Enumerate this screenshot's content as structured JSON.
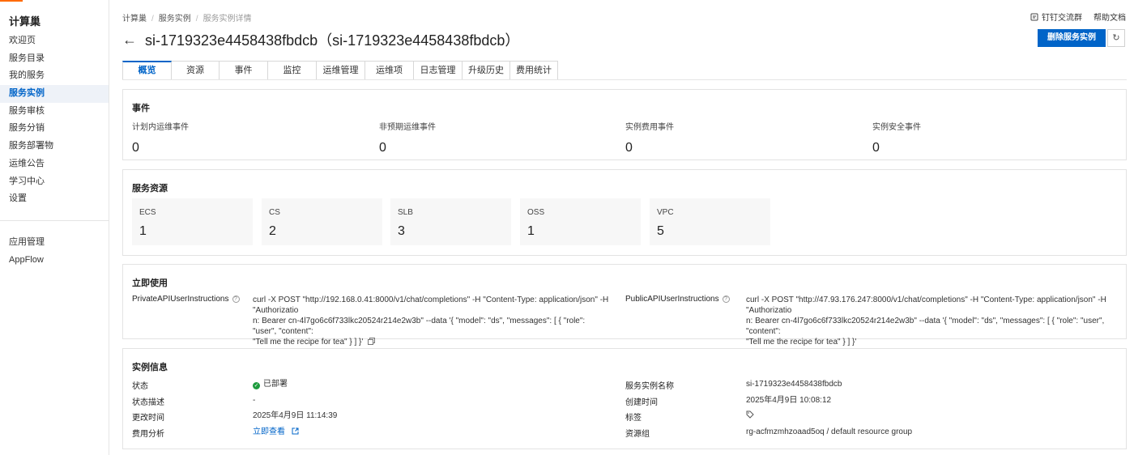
{
  "sidebar": {
    "brand": "计算巢",
    "items": [
      {
        "label": "欢迎页"
      },
      {
        "label": "服务目录"
      },
      {
        "label": "我的服务"
      },
      {
        "label": "服务实例"
      },
      {
        "label": "服务审核"
      },
      {
        "label": "服务分销"
      },
      {
        "label": "服务部署物"
      },
      {
        "label": "运维公告"
      },
      {
        "label": "学习中心"
      },
      {
        "label": "设置"
      }
    ],
    "active_index": 3,
    "items2": [
      {
        "label": "应用管理"
      },
      {
        "label": "AppFlow"
      }
    ],
    "collapse_icon": "chevron-left-icon"
  },
  "breadcrumb": [
    "计算巢",
    "服务实例",
    "服务实例详情"
  ],
  "header": {
    "title": "si-1719323e4458438fbdcb（si-1719323e4458438fbdcb）",
    "delete_button": "删除服务实例",
    "links": [
      "钉钉交流群",
      "帮助文档"
    ]
  },
  "tabs": [
    {
      "label": "概览",
      "active": true
    },
    {
      "label": "资源"
    },
    {
      "label": "事件"
    },
    {
      "label": "监控"
    },
    {
      "label": "运维管理"
    },
    {
      "label": "运维项"
    },
    {
      "label": "日志管理"
    },
    {
      "label": "升级历史"
    },
    {
      "label": "费用统计"
    }
  ],
  "events": {
    "title": "事件",
    "items": [
      {
        "label": "计划内运维事件",
        "value": "0"
      },
      {
        "label": "非预期运维事件",
        "value": "0"
      },
      {
        "label": "实例费用事件",
        "value": "0"
      },
      {
        "label": "实例安全事件",
        "value": "0"
      }
    ]
  },
  "resources": {
    "title": "服务资源",
    "items": [
      {
        "label": "ECS",
        "value": "1"
      },
      {
        "label": "CS",
        "value": "2"
      },
      {
        "label": "SLB",
        "value": "3"
      },
      {
        "label": "OSS",
        "value": "1"
      },
      {
        "label": "VPC",
        "value": "5"
      }
    ]
  },
  "usage": {
    "title": "立即使用",
    "private_label": "PrivateAPIUserInstructions",
    "private_lines": [
      "curl -X POST \"http://192.168.0.41:8000/v1/chat/completions\" -H \"Content-Type: application/json\" -H \"Authorizatio",
      "n: Bearer cn-4l7go6c6f733lkc20524r214e2w3b\" --data '{ \"model\": \"ds\", \"messages\": [ { \"role\": \"user\", \"content\":",
      "\"Tell me the recipe for tea\" } ] }'"
    ],
    "public_label": "PublicAPIUserInstructions",
    "public_lines": [
      "curl -X POST \"http://47.93.176.247:8000/v1/chat/completions\" -H \"Content-Type: application/json\" -H \"Authorizatio",
      "n: Bearer cn-4l7go6c6f733lkc20524r214e2w3b\" --data '{ \"model\": \"ds\", \"messages\": [ { \"role\": \"user\", \"content\":",
      "\"Tell me the recipe for tea\" } ] }'"
    ]
  },
  "instance_info": {
    "title": "实例信息",
    "left": [
      {
        "label": "状态",
        "value": "已部署"
      },
      {
        "label": "状态描述",
        "value": "-"
      },
      {
        "label": "更改时间",
        "value": "2025年4月9日 11:14:39"
      },
      {
        "label": "费用分析",
        "value": "立即查看"
      }
    ],
    "right": [
      {
        "label": "服务实例名称",
        "value": "si-1719323e4458438fbdcb"
      },
      {
        "label": "创建时间",
        "value": "2025年4月9日 10:08:12"
      },
      {
        "label": "标签",
        "value": ""
      },
      {
        "label": "资源组",
        "value": "rg-acfmzmhzoaad5oq / default resource group"
      }
    ]
  },
  "colors": {
    "primary": "#0064c8",
    "accent": "#ff6a00",
    "success": "#1e9c3e"
  }
}
